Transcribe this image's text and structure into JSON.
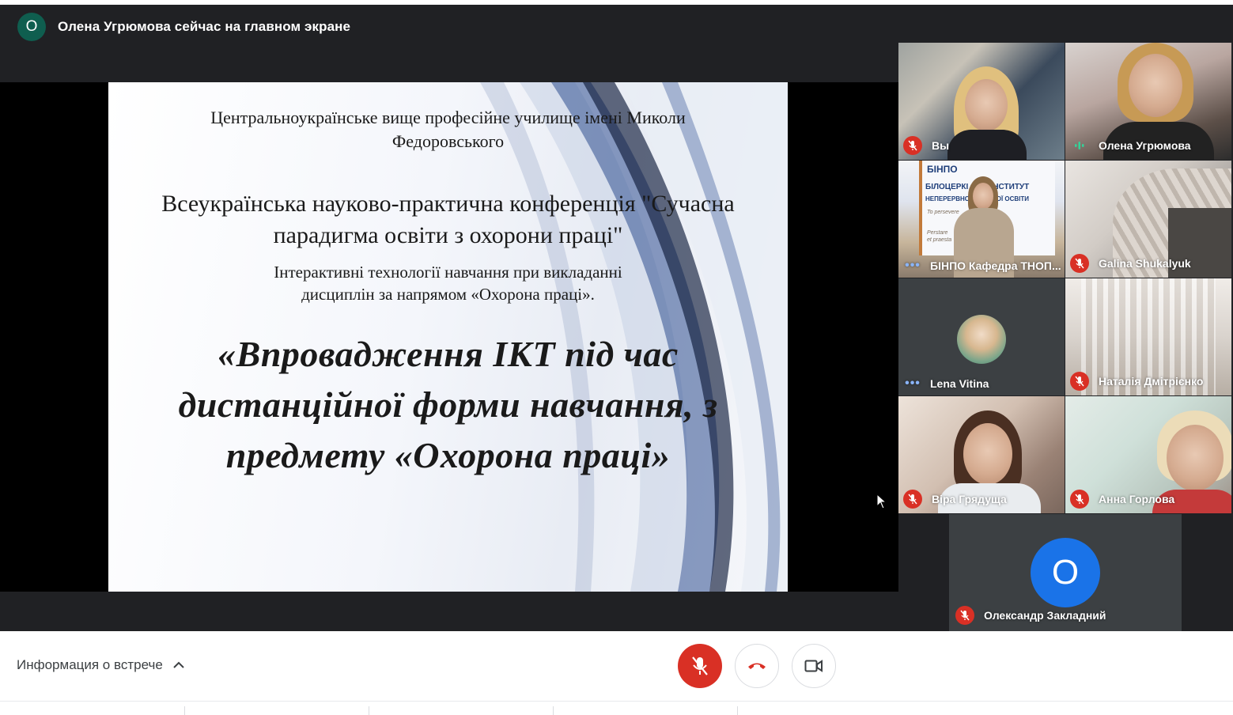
{
  "presenter": {
    "avatar_letter": "О",
    "status_text": "Олена Угрюмова сейчас на главном экране"
  },
  "slide": {
    "institution": "Центральноукраїнське вище професійне училище імені Миколи Федоровського",
    "conference": "Всеукраїнська науково-практична конференція \"Сучасна парадигма освіти з охорони праці\"",
    "subtitle": "Інтерактивні технології навчання при викладанні дисциплін за напрямом «Охорона праці».",
    "topic": "«Впровадження ІКТ під час дистанційної форми навчання, з предмету «Охорона праці»"
  },
  "participants": [
    {
      "name": "Вы",
      "state": "muted"
    },
    {
      "name": "Олена Угрюмова",
      "state": "speaking"
    },
    {
      "name": "БІНПО Кафедра ТНОП...",
      "state": "dots"
    },
    {
      "name": "Galina Shukalyuk",
      "state": "muted"
    },
    {
      "name": "Lena Vitina",
      "state": "dots"
    },
    {
      "name": "Наталія Дмітрієнко",
      "state": "muted"
    },
    {
      "name": "Віра Грядуща",
      "state": "muted"
    },
    {
      "name": "Анна Горлова",
      "state": "muted"
    },
    {
      "name": "Олександр Закладний",
      "state": "muted",
      "avatar_letter": "О"
    }
  ],
  "tile_text": {
    "banner_brand": "БІНПО",
    "banner_line1": "БІЛОЦЕРКІ    ИЙ ІНСТИТУТ",
    "banner_line2": "НЕПЕРЕРВНО    ЕСІЙНОЇ ОСВІТИ",
    "banner_line3": "To persevere",
    "banner_line4": "Perstare",
    "banner_line5": "et praesta"
  },
  "bottom_bar": {
    "meeting_info_label": "Информация о встрече"
  },
  "colors": {
    "stage_bg": "#202124",
    "tile_bg": "#3c4043",
    "mute_red": "#d93025",
    "avatar_blue": "#1a73e8",
    "presenter_avatar": "#0f5e4f"
  },
  "icons": {
    "mic_off": "mic-off-icon",
    "hangup": "call-end-icon",
    "camera": "videocam-icon",
    "chevron": "chevron-up-icon"
  }
}
